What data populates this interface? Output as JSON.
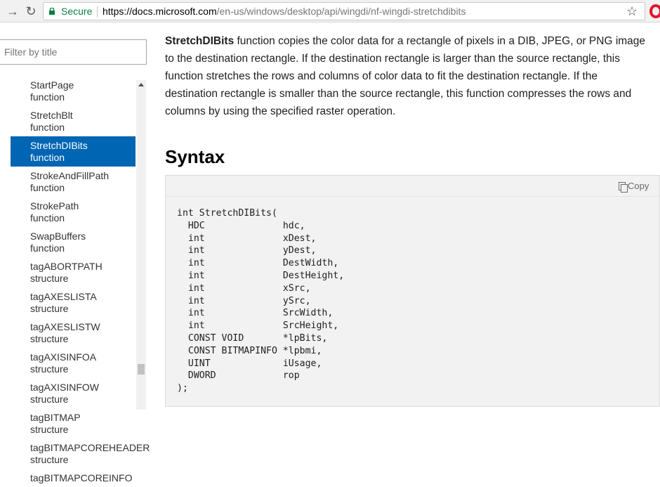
{
  "browser": {
    "back_icon": "back-arrow-icon",
    "reload_icon": "reload-icon",
    "secure_label": "Secure",
    "url_host": "https://docs.microsoft.com",
    "url_path": "/en-us/windows/desktop/api/wingdi/nf-wingdi-stretchdibits",
    "bookmark_icon": "star-icon",
    "extension_icon": "opera-icon"
  },
  "sidebar": {
    "filter_placeholder": "Filter by title",
    "items": [
      {
        "label": "StartPage function",
        "active": false
      },
      {
        "label": "StretchBlt function",
        "active": false
      },
      {
        "label": "StretchDIBits function",
        "active": true
      },
      {
        "label": "StrokeAndFillPath function",
        "active": false
      },
      {
        "label": "StrokePath function",
        "active": false
      },
      {
        "label": "SwapBuffers function",
        "active": false
      },
      {
        "label": "tagABORTPATH structure",
        "active": false
      },
      {
        "label": "tagAXESLISTA structure",
        "active": false
      },
      {
        "label": "tagAXESLISTW structure",
        "active": false
      },
      {
        "label": "tagAXISINFOA structure",
        "active": false
      },
      {
        "label": "tagAXISINFOW structure",
        "active": false
      },
      {
        "label": "tagBITMAP structure",
        "active": false
      },
      {
        "label": "tagBITMAPCOREHEADER structure",
        "active": false
      },
      {
        "label": "tagBITMAPCOREINFO",
        "active": false
      }
    ],
    "colors": {
      "active_bg": "#0065b3",
      "active_text": "#ffffff"
    }
  },
  "main": {
    "intro_bold": "StretchDIBits",
    "intro_rest": " function copies the color data for a rectangle of pixels in a DIB, JPEG, or PNG image to the destination rectangle. If the destination rectangle is larger than the source rectangle, this function stretches the rows and columns of color data to fit the destination rectangle. If the destination rectangle is smaller than the source rectangle, this function compresses the rows and columns by using the specified raster operation.",
    "syntax_heading": "Syntax",
    "copy_label": "Copy",
    "code_lines": [
      "int StretchDIBits(",
      "  HDC              hdc,",
      "  int              xDest,",
      "  int              yDest,",
      "  int              DestWidth,",
      "  int              DestHeight,",
      "  int              xSrc,",
      "  int              ySrc,",
      "  int              SrcWidth,",
      "  int              SrcHeight,",
      "  CONST VOID       *lpBits,",
      "  CONST BITMAPINFO *lpbmi,",
      "  UINT             iUsage,",
      "  DWORD            rop",
      ");"
    ]
  }
}
